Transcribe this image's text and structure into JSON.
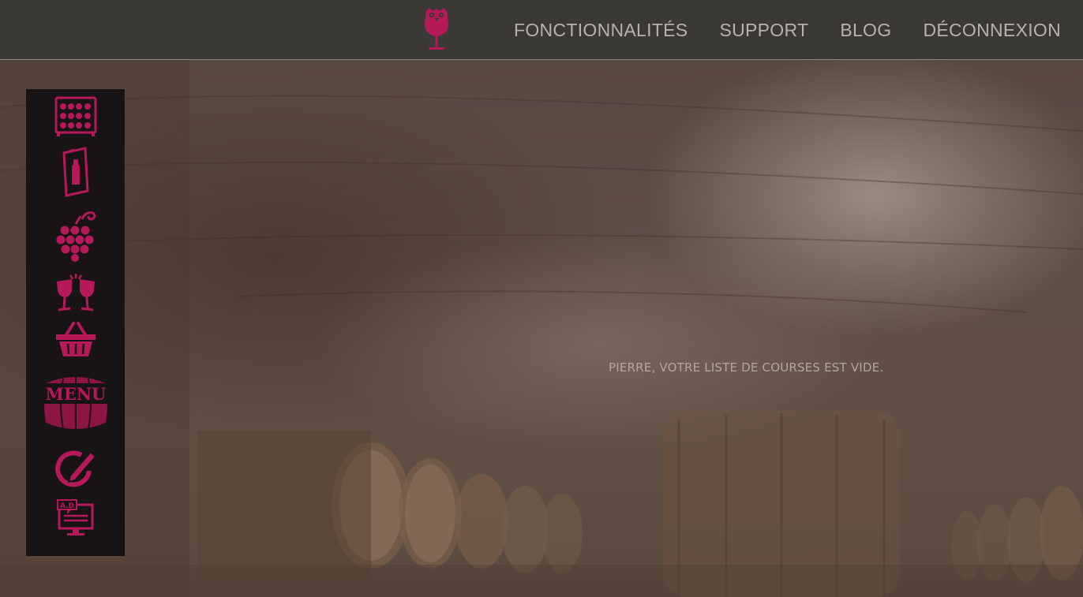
{
  "brand": {
    "logo_icon": "wine-glass-owl-icon",
    "accent_color": "#b5195a"
  },
  "nav": {
    "items": [
      {
        "label": "FONCTIONNALITÉS"
      },
      {
        "label": "SUPPORT"
      },
      {
        "label": "BLOG"
      },
      {
        "label": "DÉCONNEXION"
      }
    ]
  },
  "sidebar": {
    "items": [
      {
        "icon": "wine-rack-icon"
      },
      {
        "icon": "wine-list-icon"
      },
      {
        "icon": "grapes-icon"
      },
      {
        "icon": "toast-glasses-icon"
      },
      {
        "icon": "shopping-basket-icon"
      },
      {
        "icon": "menu-barrel-icon",
        "label": "MENU"
      },
      {
        "icon": "edit-refresh-icon"
      },
      {
        "icon": "ad-screen-icon",
        "label": "A.D"
      }
    ]
  },
  "main": {
    "empty_message": "PIERRE, VOTRE LISTE DE COURSES EST VIDE."
  }
}
